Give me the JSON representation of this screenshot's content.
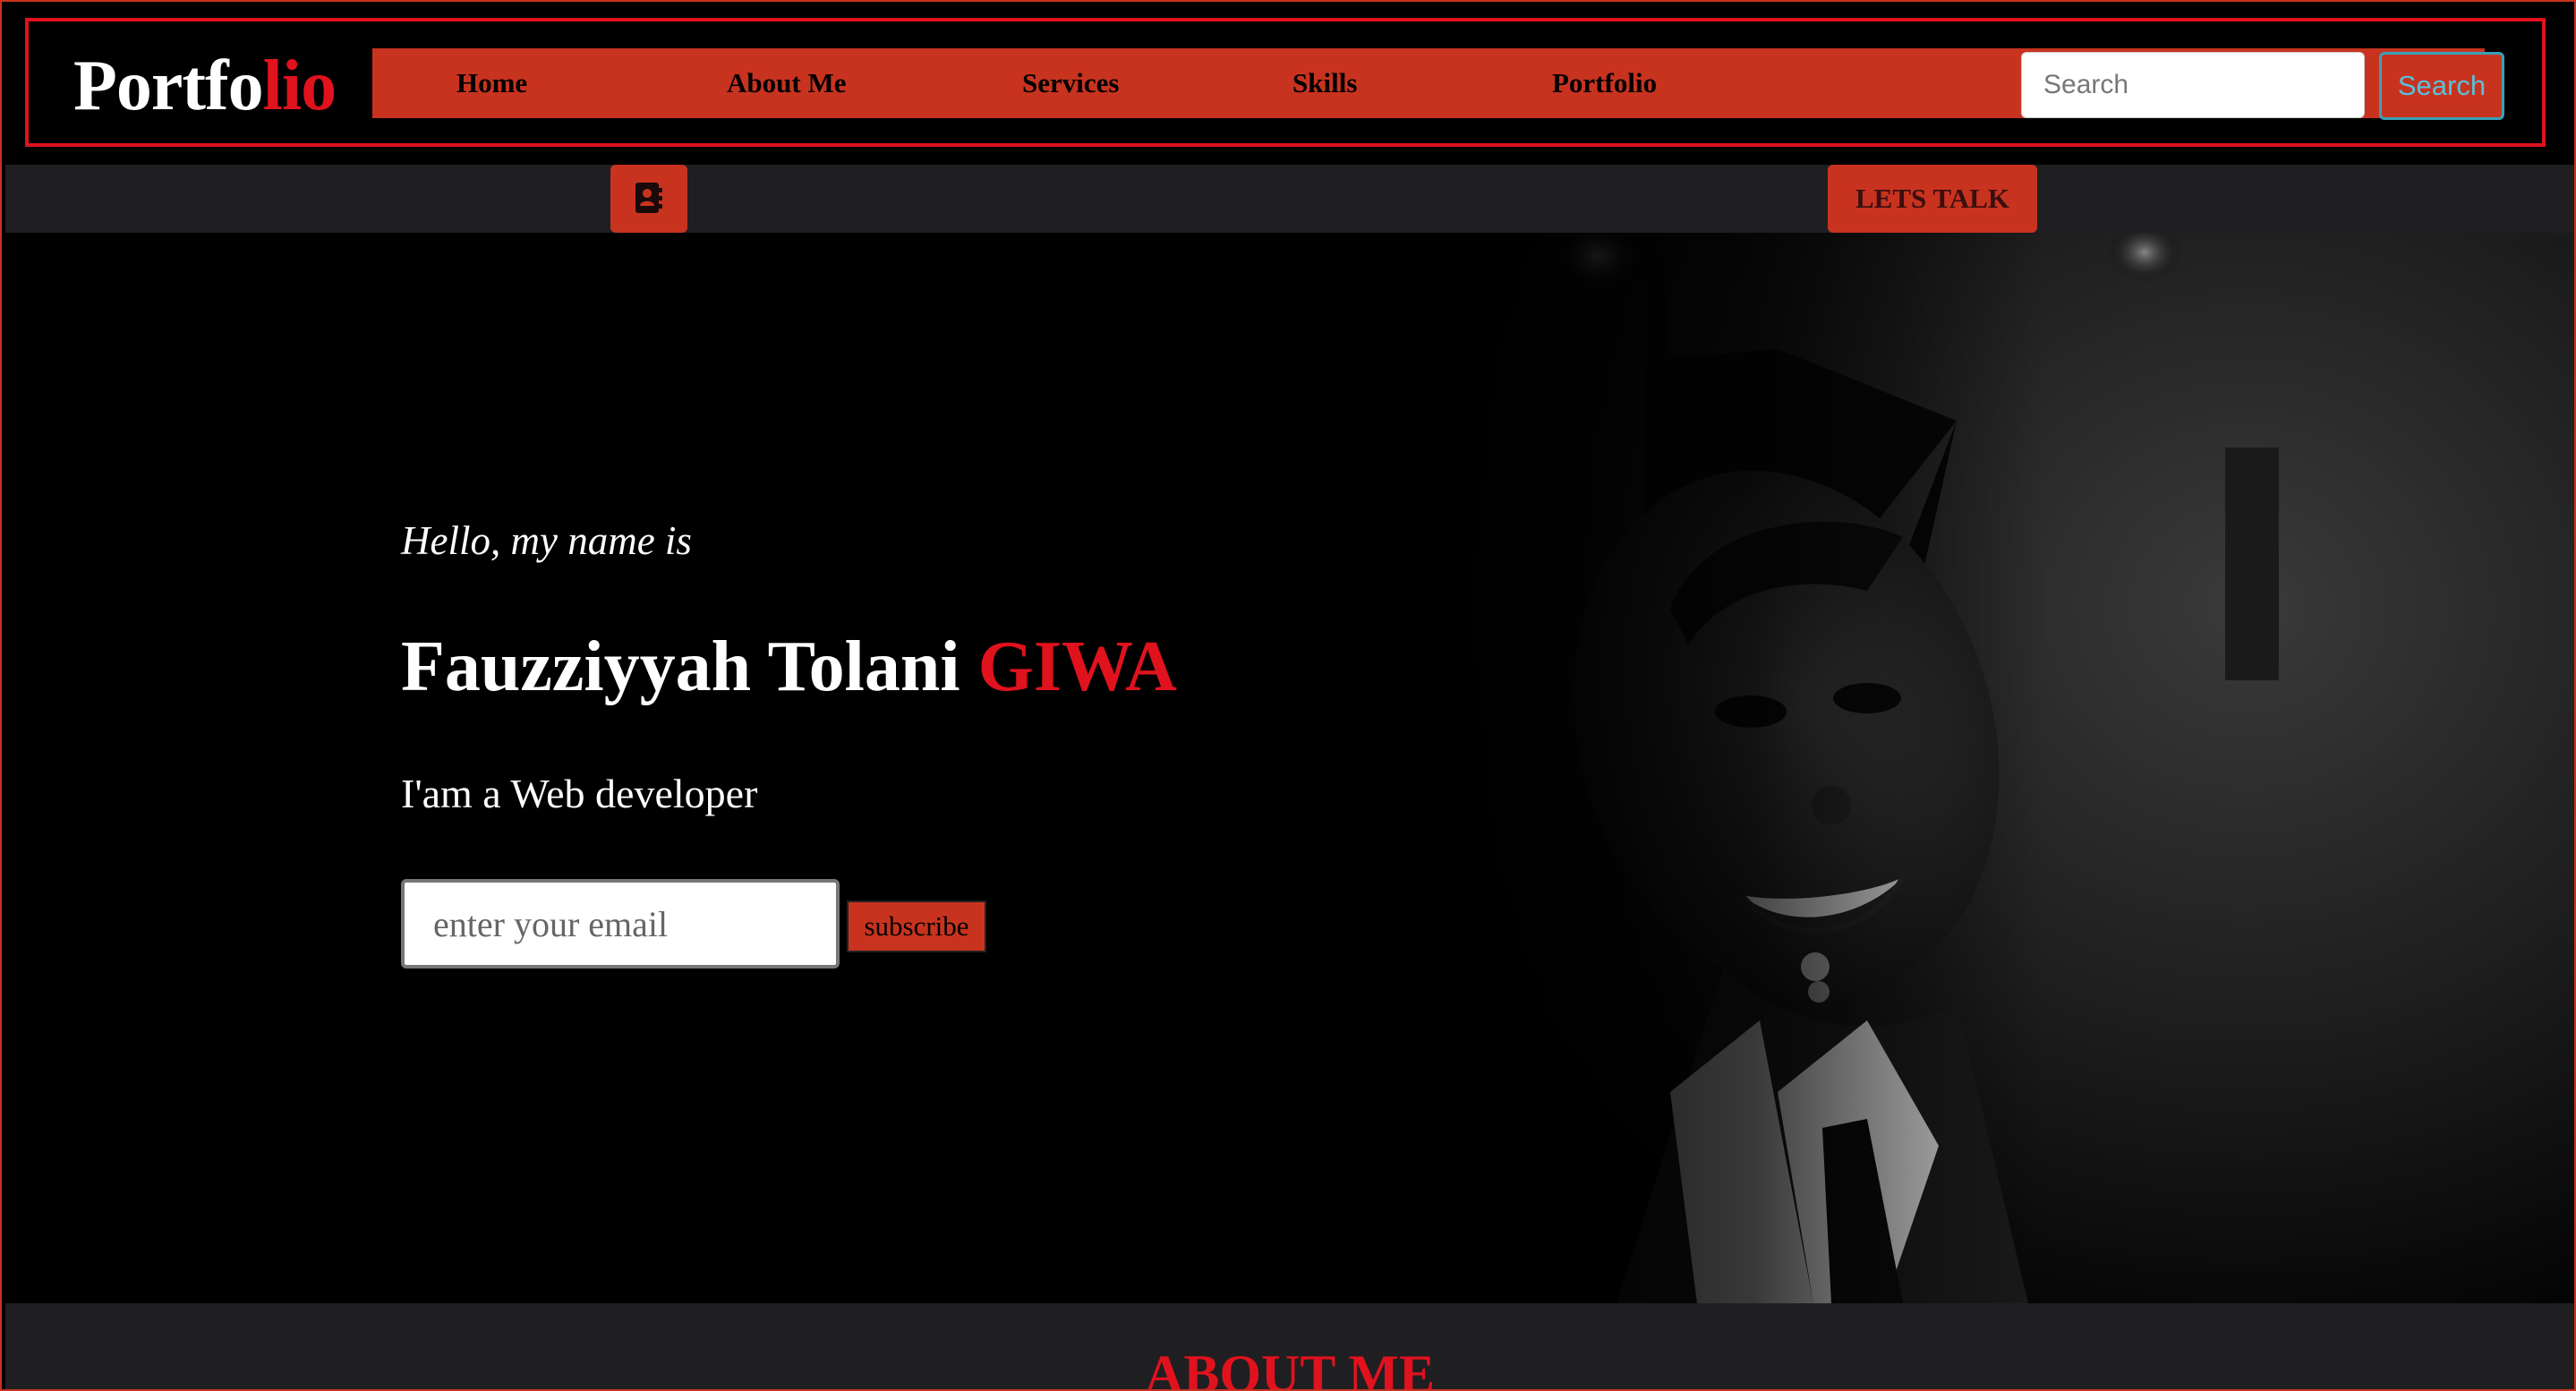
{
  "brand": {
    "prefix": "Portfo",
    "accent": "lio"
  },
  "nav": {
    "items": [
      {
        "label": "Home"
      },
      {
        "label": "About Me"
      },
      {
        "label": "Services"
      },
      {
        "label": "Skills"
      },
      {
        "label": "Portfolio"
      }
    ],
    "search_placeholder": "Search",
    "search_button": "Search"
  },
  "subbar": {
    "contact_icon": "address-book-icon",
    "talk_button": "LETS TALK"
  },
  "hero": {
    "greeting": "Hello, my name is",
    "first_names": "Fauzziyyah Tolani ",
    "last_name": "GIWA",
    "role": "I'am a Web developer",
    "email_placeholder": "enter your email",
    "subscribe_label": "subscribe",
    "photo": "graduate-portrait-photo"
  },
  "about": {
    "title": "ABOUT ME"
  },
  "colors": {
    "accent_red": "#e0121d",
    "button_red": "#c8331f",
    "bar_dark": "#1f1f22",
    "search_text": "#57c1dc"
  }
}
